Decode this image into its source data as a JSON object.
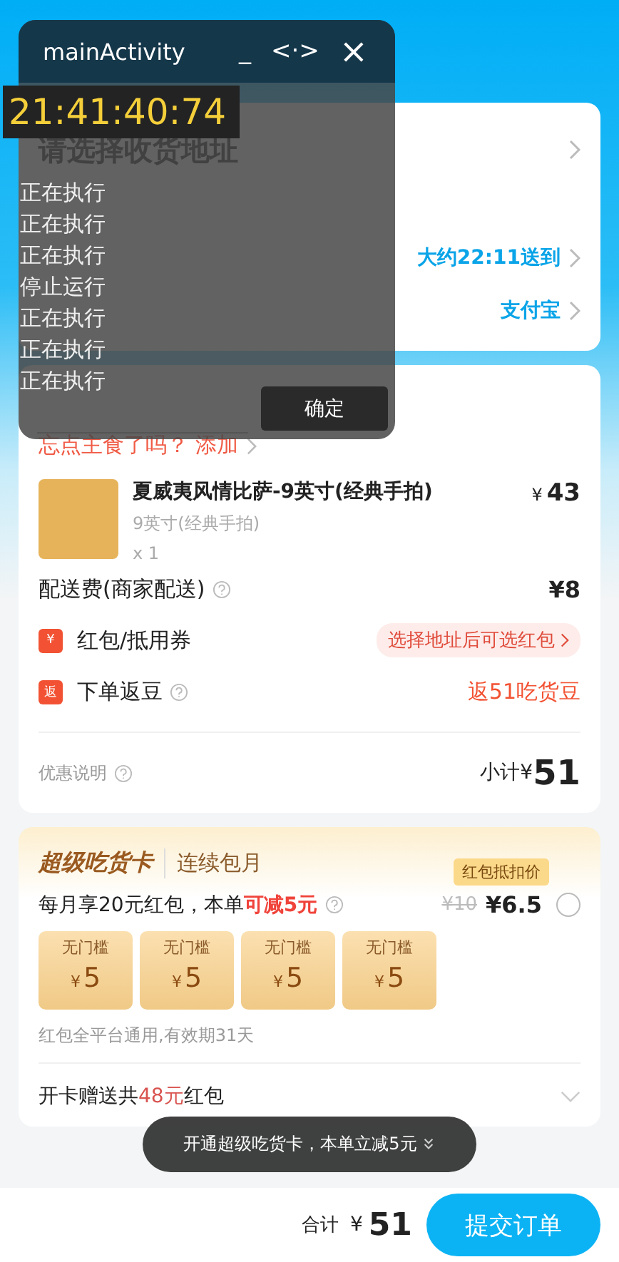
{
  "delivery": {
    "address": "请选择收货地址",
    "rows": [
      {
        "value": "大约22:11送到"
      },
      {
        "value": "支付宝"
      }
    ]
  },
  "order": {
    "upsell": "忘点主食了吗？ 添加",
    "item": {
      "name": "夏威夷风情比萨-9英寸(经典手拍)",
      "spec": "9英寸(经典手拍)",
      "qty": "x 1",
      "symbol": "¥",
      "price": "43"
    },
    "fees": [
      {
        "kind": "plain",
        "label": "配送费(商家配送)",
        "help": true,
        "value": "¥8"
      },
      {
        "kind": "coupon",
        "badge": "¥",
        "label": "红包/抵用券",
        "help": false,
        "value": "选择地址后可选红包"
      },
      {
        "kind": "cashback",
        "badge": "返",
        "label": "下单返豆",
        "help": true,
        "value": "返51吃货豆"
      }
    ],
    "discount_note": "优惠说明",
    "subtotal_label": "小计¥",
    "subtotal": "51"
  },
  "card": {
    "title": "超级吃货卡",
    "subtitle": "连续包月",
    "tag": "红包抵扣价",
    "offer": "每月享20元红包，本单",
    "offer_highlight": "可减5元",
    "old_price": "¥10",
    "price": "¥6.5",
    "selected": false,
    "coupons": [
      {
        "label": "无门槛",
        "symbol": "¥",
        "amount": "5"
      },
      {
        "label": "无门槛",
        "symbol": "¥",
        "amount": "5"
      },
      {
        "label": "无门槛",
        "symbol": "¥",
        "amount": "5"
      },
      {
        "label": "无门槛",
        "symbol": "¥",
        "amount": "5"
      }
    ],
    "note": "红包全平台通用,有效期31天",
    "gift_prefix": "开卡赠送共",
    "gift_amount": "48元",
    "gift_suffix": "红包"
  },
  "toast": {
    "text": "开通超级吃货卡，本单立减5元"
  },
  "footer": {
    "total_label": "合计",
    "symbol": "¥",
    "total": "51",
    "submit": "提交订单"
  },
  "overlay": {
    "title": "mainActivity",
    "minimize": "_",
    "resize": "<·>",
    "close": "×",
    "clock": "21:41:40:74",
    "log": [
      "正在执行",
      "正在执行",
      "正在执行",
      "停止运行",
      "正在执行",
      "正在执行",
      "正在执行"
    ],
    "confirm": "确定"
  }
}
